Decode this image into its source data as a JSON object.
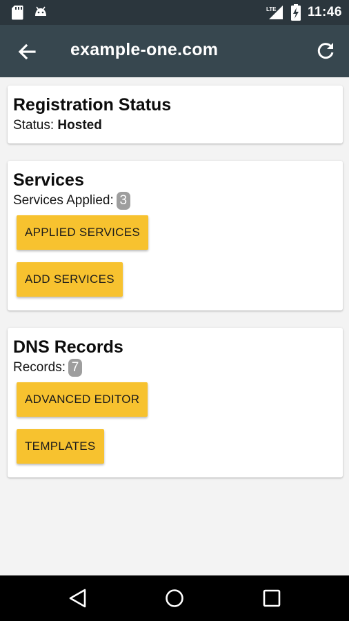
{
  "statusbar": {
    "time": "11:46",
    "network": "LTE",
    "icons": [
      "sd-card-icon",
      "android-icon",
      "lte-signal-icon",
      "battery-charging-icon"
    ]
  },
  "appbar": {
    "title": "example-one.com",
    "left_icon": "arrow-back-icon",
    "right_icon": "refresh-icon"
  },
  "registration": {
    "heading": "Registration Status",
    "status_label": "Status: ",
    "status_value": "Hosted"
  },
  "services": {
    "heading": "Services",
    "applied_label": "Services Applied:",
    "applied_count": "3",
    "buttons": [
      "APPLIED SERVICES",
      "ADD SERVICES"
    ]
  },
  "dns": {
    "heading": "DNS Records",
    "records_label": "Records:",
    "records_count": "7",
    "buttons": [
      "ADVANCED EDITOR",
      "TEMPLATES"
    ]
  },
  "navbar": {
    "icons": [
      "nav-back-icon",
      "nav-home-icon",
      "nav-recents-icon"
    ]
  },
  "colors": {
    "statusbar": "#2b363d",
    "appbar": "#37474f",
    "background": "#f3f3f3",
    "button": "#f7c22f",
    "badge": "#9e9e9e"
  }
}
